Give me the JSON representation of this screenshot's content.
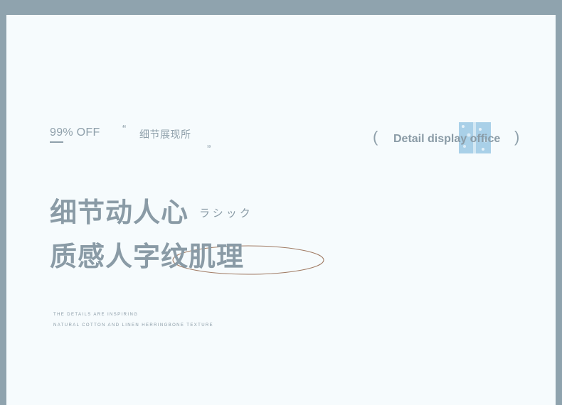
{
  "banner": {
    "discount": "99% OFF",
    "quote_open": "“",
    "subtitle_cn": "细节展现所",
    "quote_close": "„",
    "paren_open": "(",
    "title_en": "Detail display office",
    "paren_close": ")",
    "headline_line1": "细节动人心",
    "headline_kana": "ラシック",
    "headline_line2": "质感人字纹肌理",
    "tagline_1": "THE DETAILS ARE INSPIRING",
    "tagline_2": "NATURAL COTTON AND LINEN HERRINGBONE TEXTURE"
  },
  "colors": {
    "frame": "#8fa3ae",
    "panel": "#f6fbfd",
    "text": "#8a9ba6",
    "ellipse": "#8b5a3c",
    "swatch": "#a9d0e8"
  }
}
